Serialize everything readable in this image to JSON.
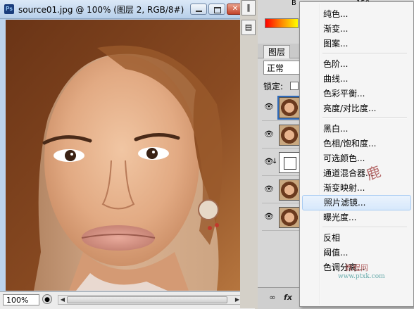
{
  "document": {
    "title": "source01.jpg @ 100% (图层 2, RGB/8#)",
    "zoom": "100%"
  },
  "color_panel": {
    "label": "B",
    "value": "150"
  },
  "layers_panel": {
    "tab": "图层",
    "blend_mode": "正常",
    "lock_label": "锁定:",
    "rows": [
      {
        "type": "photo",
        "selected": true
      },
      {
        "type": "photo",
        "selected": false
      },
      {
        "type": "adjustment",
        "selected": false
      },
      {
        "type": "photo",
        "selected": false
      },
      {
        "type": "photo",
        "selected": false
      }
    ]
  },
  "menu": {
    "items": [
      {
        "label": "纯色...",
        "highlighted": false
      },
      {
        "label": "渐变...",
        "highlighted": false
      },
      {
        "label": "图案...",
        "highlighted": false
      },
      {
        "sep": true
      },
      {
        "label": "色阶...",
        "highlighted": false
      },
      {
        "label": "曲线...",
        "highlighted": false
      },
      {
        "label": "色彩平衡...",
        "highlighted": false
      },
      {
        "label": "亮度/对比度...",
        "highlighted": false
      },
      {
        "sep": true
      },
      {
        "label": "黑白...",
        "highlighted": false
      },
      {
        "label": "色相/饱和度...",
        "highlighted": false
      },
      {
        "label": "可选颜色...",
        "highlighted": false
      },
      {
        "label": "通道混合器...",
        "highlighted": false
      },
      {
        "label": "渐变映射...",
        "highlighted": false
      },
      {
        "label": "照片滤镜...",
        "highlighted": true
      },
      {
        "label": "曝光度...",
        "highlighted": false
      },
      {
        "sep": true
      },
      {
        "label": "反相",
        "highlighted": false
      },
      {
        "label": "阈值...",
        "highlighted": false
      },
      {
        "label": "色调分离...",
        "highlighted": false
      }
    ]
  },
  "watermark": {
    "site": "www.68ps.com",
    "site2": "www.ptxk.com",
    "text1": "鹿",
    "text2": "教程网"
  },
  "icons": {
    "ps": "photoshop-app-icon",
    "eye": "eye-icon"
  }
}
